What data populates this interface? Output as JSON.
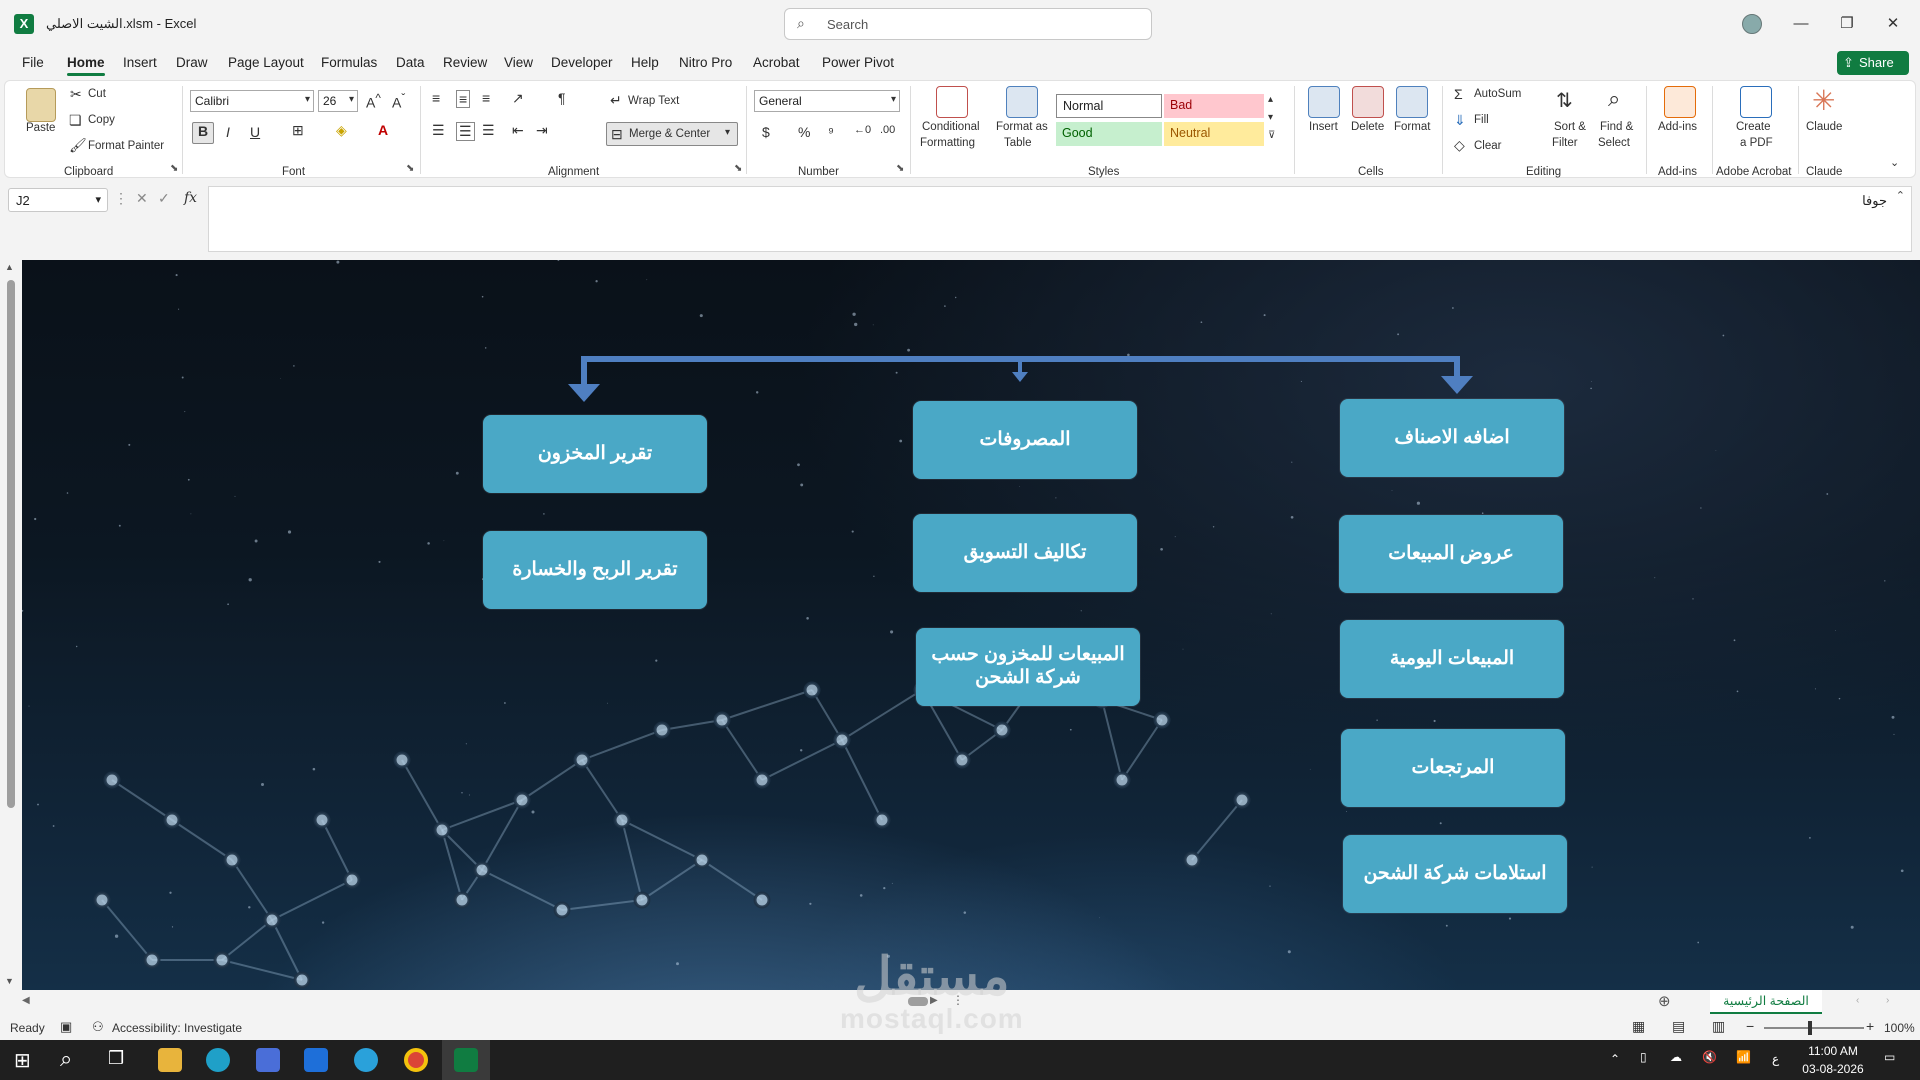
{
  "window": {
    "title": "الشيت الاصلي.xlsm  -  Excel",
    "search_placeholder": "Search"
  },
  "menu": {
    "items": [
      "File",
      "Home",
      "Insert",
      "Draw",
      "Page Layout",
      "Formulas",
      "Data",
      "Review",
      "View",
      "Developer",
      "Help",
      "Nitro Pro",
      "Acrobat",
      "Power Pivot"
    ],
    "active": "Home",
    "share_label": "Share"
  },
  "ribbon": {
    "clipboard": {
      "paste": "Paste",
      "cut": "Cut",
      "copy": "Copy",
      "format_painter": "Format Painter",
      "group": "Clipboard"
    },
    "font": {
      "family": "Calibri",
      "size": "26",
      "bold": "B",
      "italic": "I",
      "underline": "U",
      "group": "Font"
    },
    "alignment": {
      "wrap_text": "Wrap Text",
      "merge_center": "Merge & Center",
      "group": "Alignment"
    },
    "number": {
      "format": "General",
      "group": "Number"
    },
    "styles": {
      "conditional_line1": "Conditional",
      "conditional_line2": "Formatting",
      "format_table_line1": "Format as",
      "format_table_line2": "Table",
      "normal": "Normal",
      "bad": "Bad",
      "good": "Good",
      "neutral": "Neutral",
      "group": "Styles"
    },
    "cells": {
      "insert": "Insert",
      "delete": "Delete",
      "format": "Format",
      "group": "Cells"
    },
    "editing": {
      "autosum": "AutoSum",
      "fill": "Fill",
      "clear": "Clear",
      "sort_line1": "Sort &",
      "sort_line2": "Filter",
      "find_line1": "Find &",
      "find_line2": "Select",
      "group": "Editing"
    },
    "addins": {
      "label": "Add-ins",
      "group": "Add-ins"
    },
    "acrobat": {
      "line1": "Create",
      "line2": "a PDF",
      "group": "Adobe Acrobat"
    },
    "claude": {
      "label": "Claude",
      "group": "Claude"
    }
  },
  "formula_bar": {
    "name_box": "J2",
    "fx": "fx",
    "value": "جوفا"
  },
  "diagram": {
    "nodes": [
      {
        "text": "تقرير المخزون"
      },
      {
        "text": "تقرير الربح والخسارة"
      },
      {
        "text": "المصروفات"
      },
      {
        "text": "تكاليف التسويق"
      },
      {
        "text": "المبيعات للمخزون حسب شركة الشحن"
      },
      {
        "text": "اضافه الاصناف"
      },
      {
        "text": "عروض المبيعات"
      },
      {
        "text": "المبيعات اليومية"
      },
      {
        "text": "المرتجعات"
      },
      {
        "text": "استلامات شركة الشحن"
      }
    ],
    "colors": {
      "node": "#4aa8c6",
      "connector": "#4f7fc1"
    }
  },
  "sheet_tabs": {
    "active": "الصفحة الرئيسية"
  },
  "status": {
    "ready": "Ready",
    "accessibility": "Accessibility: Investigate",
    "zoom": "100%"
  },
  "taskbar": {
    "time": "11:00 AM",
    "date": "03-08-2026",
    "lang": "ع"
  },
  "watermark": {
    "arabic": "مستقل",
    "latin": "mostaql.com"
  }
}
